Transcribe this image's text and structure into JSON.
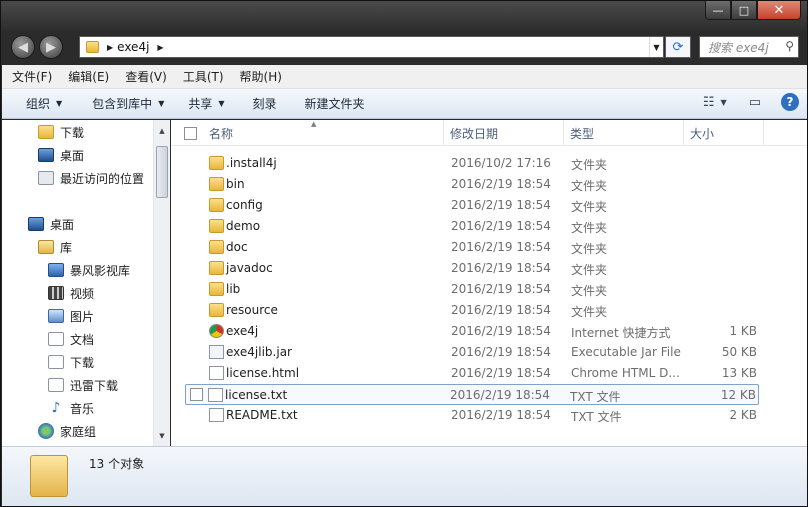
{
  "window": {
    "caption_min": "—",
    "caption_max": "□",
    "caption_close": "✕"
  },
  "address": {
    "path_segment": "exe4j",
    "search_placeholder": "搜索 exe4j"
  },
  "menu": [
    "文件(F)",
    "编辑(E)",
    "查看(V)",
    "工具(T)",
    "帮助(H)"
  ],
  "commands": {
    "organize": "组织",
    "include_library": "包含到库中",
    "share": "共享",
    "burn": "刻录",
    "new_folder": "新建文件夹",
    "help": "?"
  },
  "nav": {
    "items": [
      {
        "label": "下载",
        "icon": "download-folder-icon"
      },
      {
        "label": "桌面",
        "icon": "desktop-icon"
      },
      {
        "label": "最近访问的位置",
        "icon": "recent-places-icon"
      },
      {
        "label": "桌面",
        "icon": "desktop-icon"
      },
      {
        "label": "库",
        "icon": "library-icon"
      },
      {
        "label": "暴风影视库",
        "icon": "media-library-icon"
      },
      {
        "label": "视频",
        "icon": "video-icon"
      },
      {
        "label": "图片",
        "icon": "pictures-icon"
      },
      {
        "label": "文档",
        "icon": "documents-icon"
      },
      {
        "label": "下载",
        "icon": "download-icon"
      },
      {
        "label": "迅雷下载",
        "icon": "thunder-download-icon"
      },
      {
        "label": "音乐",
        "icon": "music-icon"
      },
      {
        "label": "家庭组",
        "icon": "homegroup-icon"
      }
    ]
  },
  "columns": {
    "name": "名称",
    "date": "修改日期",
    "type": "类型",
    "size": "大小"
  },
  "files": [
    {
      "name": ".install4j",
      "date": "2016/10/2 17:16",
      "type": "文件夹",
      "size": "",
      "icon": "folder-icon"
    },
    {
      "name": "bin",
      "date": "2016/2/19 18:54",
      "type": "文件夹",
      "size": "",
      "icon": "folder-icon"
    },
    {
      "name": "config",
      "date": "2016/2/19 18:54",
      "type": "文件夹",
      "size": "",
      "icon": "folder-icon"
    },
    {
      "name": "demo",
      "date": "2016/2/19 18:54",
      "type": "文件夹",
      "size": "",
      "icon": "folder-icon"
    },
    {
      "name": "doc",
      "date": "2016/2/19 18:54",
      "type": "文件夹",
      "size": "",
      "icon": "folder-icon"
    },
    {
      "name": "javadoc",
      "date": "2016/2/19 18:54",
      "type": "文件夹",
      "size": "",
      "icon": "folder-icon"
    },
    {
      "name": "lib",
      "date": "2016/2/19 18:54",
      "type": "文件夹",
      "size": "",
      "icon": "folder-icon"
    },
    {
      "name": "resource",
      "date": "2016/2/19 18:54",
      "type": "文件夹",
      "size": "",
      "icon": "folder-icon"
    },
    {
      "name": "exe4j",
      "date": "2016/2/19 18:54",
      "type": "Internet 快捷方式",
      "size": "1 KB",
      "icon": "chrome-shortcut-icon"
    },
    {
      "name": "exe4jlib.jar",
      "date": "2016/2/19 18:54",
      "type": "Executable Jar File",
      "size": "50 KB",
      "icon": "jar-file-icon"
    },
    {
      "name": "license.html",
      "date": "2016/2/19 18:54",
      "type": "Chrome HTML D...",
      "size": "13 KB",
      "icon": "html-file-icon"
    },
    {
      "name": "license.txt",
      "date": "2016/2/19 18:54",
      "type": "TXT 文件",
      "size": "12 KB",
      "icon": "text-file-icon",
      "selected": true
    },
    {
      "name": "README.txt",
      "date": "2016/2/19 18:54",
      "type": "TXT 文件",
      "size": "2 KB",
      "icon": "text-file-icon"
    }
  ],
  "status": {
    "count": "13 个对象"
  }
}
